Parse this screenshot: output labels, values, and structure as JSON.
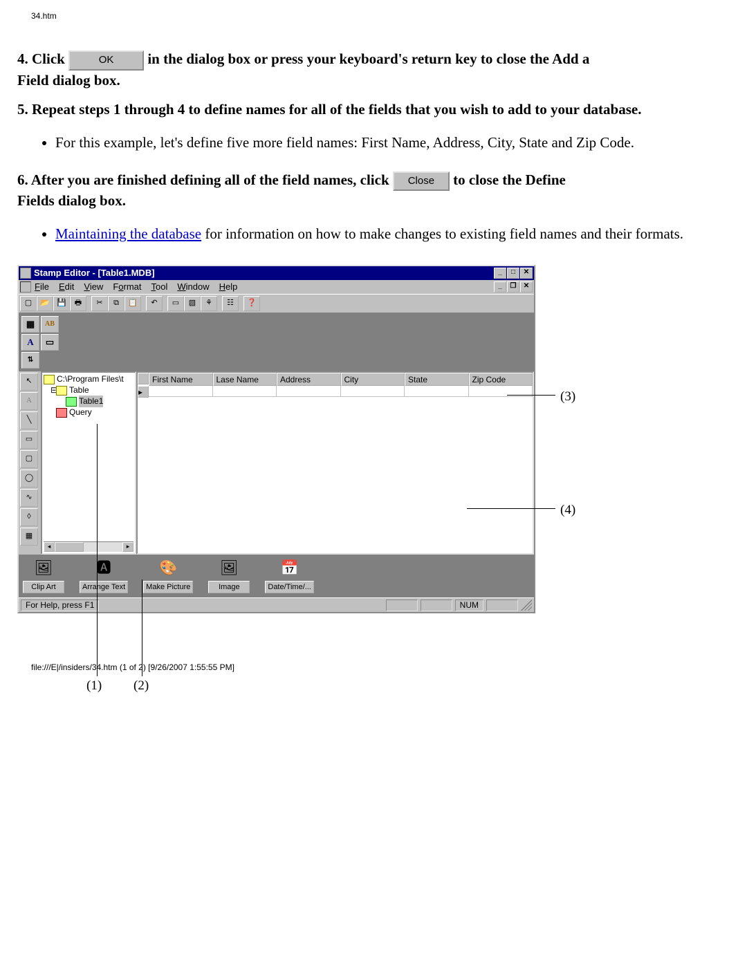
{
  "pageHeader": "34.htm",
  "step4": {
    "prefix": "4. Click ",
    "okLabel": "OK",
    "suffixA": " in the dialog box or press your keyboard's return key to close the Add a ",
    "suffixB": "Field dialog box."
  },
  "step5": {
    "line": "5. Repeat steps 1 through 4 to define names for all of the fields that you wish to add to your database.",
    "bullet": "For this example, let's define five more field names: First Name, Address, City, State and Zip Code."
  },
  "step6": {
    "prefix": "6. After you are finished defining all of the field names, click ",
    "closeLabel": "Close",
    "suffixA": " to close the Define ",
    "suffixB": "Fields dialog box."
  },
  "bullet7": {
    "linkText": "Maintaining the database",
    "rest": " for information on how to make changes to existing field names and their formats."
  },
  "screenshot": {
    "titleBar": "Stamp Editor - [Table1.MDB]",
    "menus": [
      "File",
      "Edit",
      "View",
      "Format",
      "Tool",
      "Window",
      "Help"
    ],
    "tree": {
      "root": "C:\\Program Files\\t",
      "table": "Table",
      "table1": "Table1",
      "query": "Query"
    },
    "columns": [
      "First Name",
      "Lase Name",
      "Address",
      "City",
      "State",
      "Zip Code"
    ],
    "bottomTools": [
      "Clip Art",
      "Arrange Text",
      "Make Picture",
      "Image",
      "Date/Time/..."
    ],
    "statusText": "For Help, press F1",
    "numLock": "NUM"
  },
  "callouts": {
    "c1": "(1)",
    "c2": "(2)",
    "c3": "(3)",
    "c4": "(4)"
  },
  "pageFooter": "file:///E|/insiders/34.htm (1 of 2) [9/26/2007 1:55:55 PM]"
}
